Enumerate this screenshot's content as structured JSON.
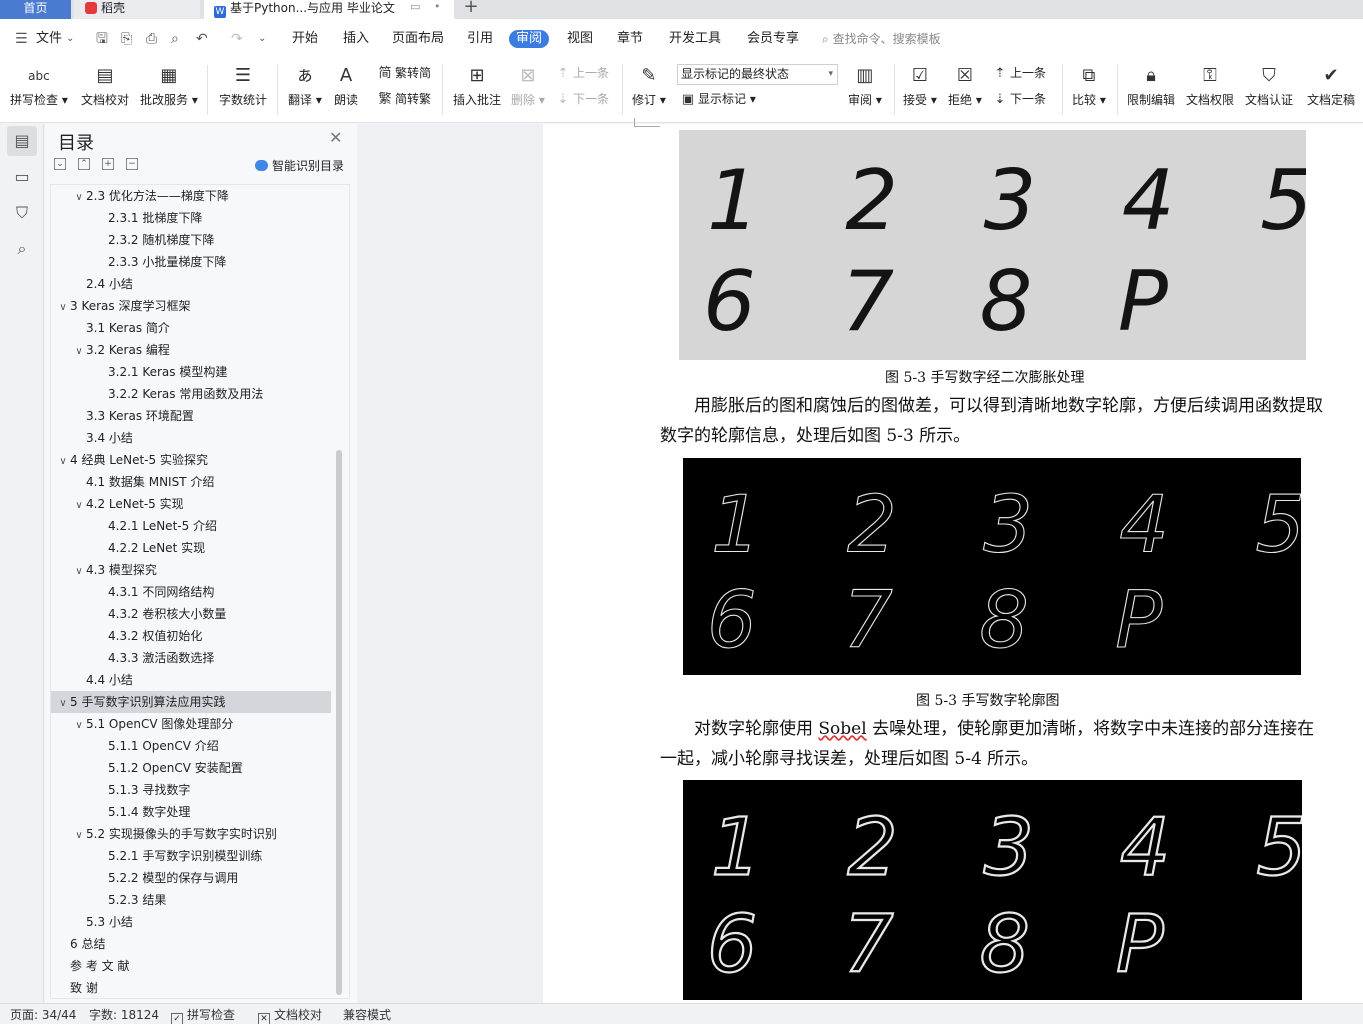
{
  "tabs": {
    "home": "首页",
    "daoke": "稻壳",
    "doc": "基于Python...与应用 毕业论文",
    "add": "+"
  },
  "menu": {
    "file": "文件",
    "items": [
      "开始",
      "插入",
      "页面布局",
      "引用",
      "审阅",
      "视图",
      "章节",
      "开发工具",
      "会员专享"
    ],
    "active_item": "审阅",
    "search": "查找命令、搜索模板"
  },
  "ribbon": {
    "spell": "拼写检查",
    "proof": "文档校对",
    "correct": "批改服务",
    "wordcount": "字数统计",
    "translate": "翻译",
    "read": "朗读",
    "trad_to_simp": "繁转简",
    "simp_to_trad": "简转繁",
    "insert_comment": "插入批注",
    "delete": "删除",
    "prev": "上一条",
    "next": "下一条",
    "revise": "修订",
    "markup_state": "显示标记的最终状态",
    "show_markup": "显示标记",
    "review": "审阅",
    "accept": "接受",
    "reject": "拒绝",
    "prev2": "上一条",
    "next2": "下一条",
    "compare": "比较",
    "restrict": "限制编辑",
    "permission": "文档权限",
    "certify": "文档认证",
    "finalize": "文档定稿"
  },
  "toc": {
    "title": "目录",
    "smart": "智能识别目录",
    "items": [
      {
        "label": "2.3  优化方法——梯度下降",
        "level": 2,
        "chev": "v"
      },
      {
        "label": "2.3.1  批梯度下降",
        "level": 3,
        "chev": ""
      },
      {
        "label": "2.3.2  随机梯度下降",
        "level": 3,
        "chev": ""
      },
      {
        "label": "2.3.3  小批量梯度下降",
        "level": 3,
        "chev": ""
      },
      {
        "label": "2.4  小结",
        "level": 2,
        "chev": ""
      },
      {
        "label": "3 Keras 深度学习框架",
        "level": 1,
        "chev": "v"
      },
      {
        "label": "3.1 Keras 简介",
        "level": 2,
        "chev": ""
      },
      {
        "label": "3.2 Keras 编程",
        "level": 2,
        "chev": "v"
      },
      {
        "label": "3.2.1 Keras 模型构建",
        "level": 3,
        "chev": ""
      },
      {
        "label": "3.2.2 Keras 常用函数及用法",
        "level": 3,
        "chev": ""
      },
      {
        "label": "3.3 Keras 环境配置",
        "level": 2,
        "chev": ""
      },
      {
        "label": "3.4  小结",
        "level": 2,
        "chev": ""
      },
      {
        "label": "4  经典 LeNet-5 实验探究",
        "level": 1,
        "chev": "v"
      },
      {
        "label": "4.1  数据集 MNIST 介绍",
        "level": 2,
        "chev": ""
      },
      {
        "label": "4.2 LeNet-5 实现",
        "level": 2,
        "chev": "v"
      },
      {
        "label": "4.2.1 LeNet-5 介绍",
        "level": 3,
        "chev": ""
      },
      {
        "label": "4.2.2 LeNet 实现",
        "level": 3,
        "chev": ""
      },
      {
        "label": "4.3  模型探究",
        "level": 2,
        "chev": "v"
      },
      {
        "label": "4.3.1  不同网络结构",
        "level": 3,
        "chev": ""
      },
      {
        "label": "4.3.2  卷积核大小数量",
        "level": 3,
        "chev": ""
      },
      {
        "label": "4.3.2  权值初始化",
        "level": 3,
        "chev": ""
      },
      {
        "label": "4.3.3  激活函数选择",
        "level": 3,
        "chev": ""
      },
      {
        "label": "4.4  小结",
        "level": 2,
        "chev": ""
      },
      {
        "label": "5  手写数字识别算法应用实践",
        "level": 1,
        "chev": "v",
        "selected": true
      },
      {
        "label": "5.1 OpenCV 图像处理部分",
        "level": 2,
        "chev": "v"
      },
      {
        "label": "5.1.1 OpenCV 介绍",
        "level": 3,
        "chev": ""
      },
      {
        "label": "5.1.2 OpenCV 安装配置",
        "level": 3,
        "chev": ""
      },
      {
        "label": "5.1.3  寻找数字",
        "level": 3,
        "chev": ""
      },
      {
        "label": "5.1.4  数字处理",
        "level": 3,
        "chev": ""
      },
      {
        "label": "5.2  实现摄像头的手写数字实时识别",
        "level": 2,
        "chev": "v"
      },
      {
        "label": "5.2.1  手写数字识别模型训练",
        "level": 3,
        "chev": ""
      },
      {
        "label": "5.2.2  模型的保存与调用",
        "level": 3,
        "chev": ""
      },
      {
        "label": "5.2.3  结果",
        "level": 3,
        "chev": ""
      },
      {
        "label": "5.3 小结",
        "level": 2,
        "chev": ""
      },
      {
        "label": "6  总结",
        "level": 1,
        "chev": ""
      },
      {
        "label": "参 考 文 献",
        "level": 1,
        "chev": ""
      },
      {
        "label": "致  谢",
        "level": 1,
        "chev": ""
      }
    ]
  },
  "document": {
    "figures": [
      {
        "digits_top": [
          "1",
          "2",
          "3",
          "4",
          "5"
        ],
        "digits_bottom": [
          "6",
          "7",
          "8",
          "P"
        ],
        "style": "light"
      },
      {
        "digits_top": [
          "1",
          "2",
          "3",
          "4",
          "5"
        ],
        "digits_bottom": [
          "6",
          "7",
          "8",
          "P"
        ],
        "style": "dark-thin"
      },
      {
        "digits_top": [
          "1",
          "2",
          "3",
          "4",
          "5"
        ],
        "digits_bottom": [
          "6",
          "7",
          "8",
          "P"
        ],
        "style": "dark-bold"
      }
    ],
    "caption1": "图 5-3  手写数字经二次膨胀处理",
    "para1": "用膨胀后的图和腐蚀后的图做差，可以得到清晰地数字轮廓，方便后续调用函数提取数字的轮廓信息，处理后如图 5-3 所示。",
    "caption2": "图 5-3  手写数字轮廓图",
    "para2_before": "对数字轮廓使用 ",
    "para2_sobel": "Sobel",
    "para2_after": " 去噪处理，使轮廓更加清晰，将数字中未连接的部分连接在一起，减小轮廓寻找误差，处理后如图 5-4 所示。"
  },
  "status": {
    "page": "页面: 34/44",
    "words": "字数: 18124",
    "spell": "拼写检查",
    "proof": "文档校对",
    "compat": "兼容模式"
  }
}
